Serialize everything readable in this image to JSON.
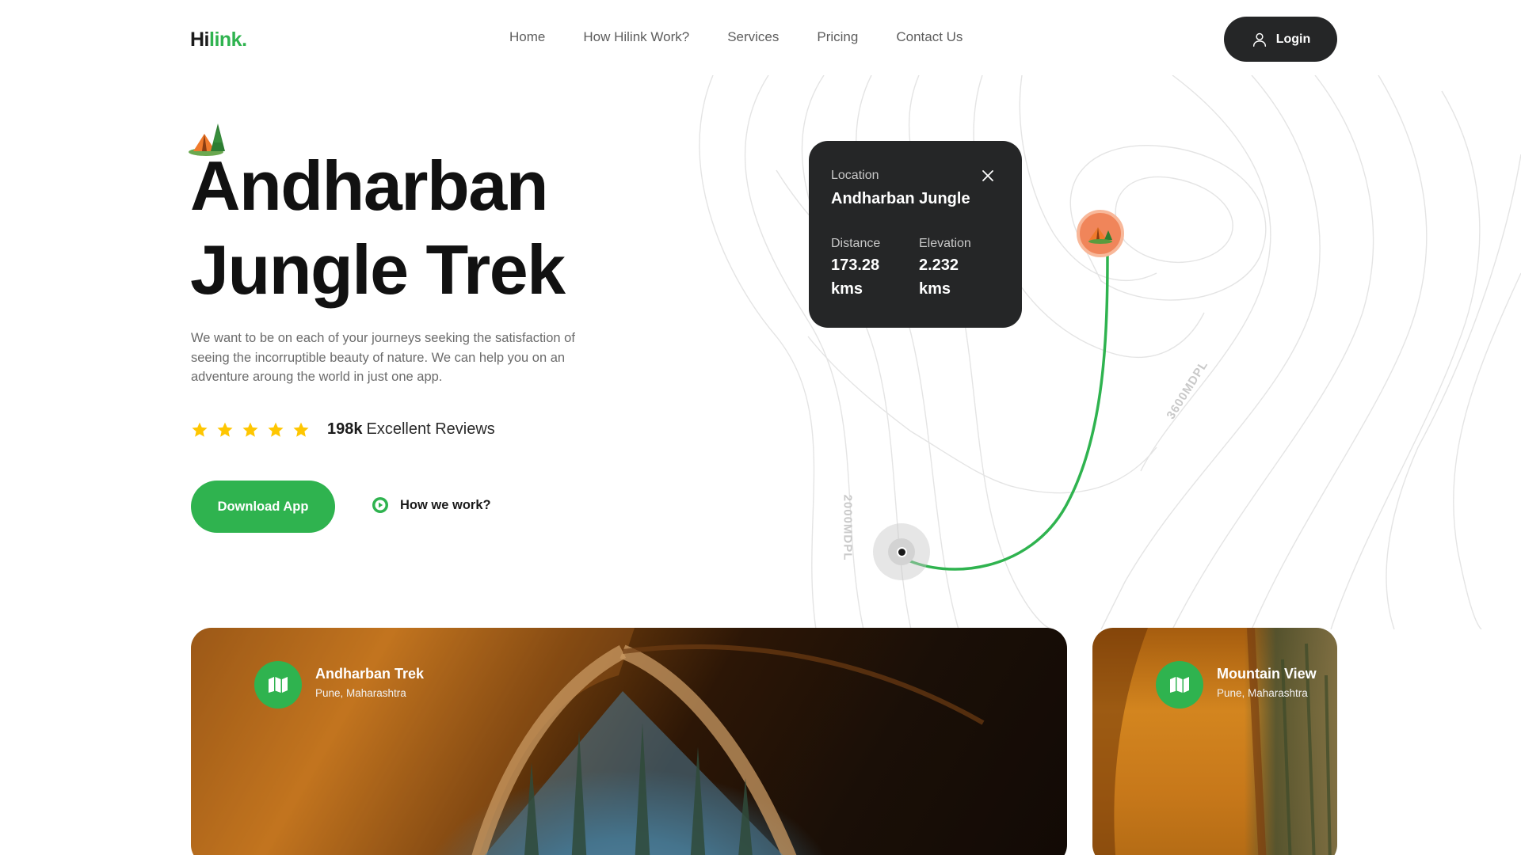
{
  "brand": {
    "logo_part1": "Hi",
    "logo_part2": "link."
  },
  "nav": {
    "items": [
      {
        "label": "Home"
      },
      {
        "label": "How Hilink Work?"
      },
      {
        "label": "Services"
      },
      {
        "label": "Pricing"
      },
      {
        "label": "Contact Us"
      }
    ],
    "login_label": "Login"
  },
  "hero": {
    "title_line1": "Andharban",
    "title_line2": "Jungle Trek",
    "description": "We want to be on each of your journeys seeking the satisfaction of seeing the incorruptible beauty of nature. We can help you on an adventure aroung the world in just one app.",
    "rating_stars": 5,
    "reviews_count": "198k",
    "reviews_label": "Excellent Reviews",
    "download_label": "Download App",
    "how_label": "How we work?"
  },
  "map": {
    "card": {
      "location_label": "Location",
      "location_value": "Andharban Jungle",
      "distance_label": "Distance",
      "distance_value": "173.28 kms",
      "elevation_label": "Elevation",
      "elevation_value": "2.232 kms"
    },
    "altitude_labels": [
      "2000MDPL",
      "3600MDPL"
    ]
  },
  "cards": [
    {
      "title": "Andharban Trek",
      "subtitle": "Pune, Maharashtra"
    },
    {
      "title": "Mountain View",
      "subtitle": "Pune, Maharashtra"
    }
  ],
  "colors": {
    "accent": "#2fb34f",
    "dark": "#252627",
    "pin": "#f0855a",
    "star": "#fec601"
  },
  "icons": [
    "user-icon",
    "play-icon",
    "star-icon",
    "camp-icon",
    "close-icon",
    "map-icon"
  ]
}
